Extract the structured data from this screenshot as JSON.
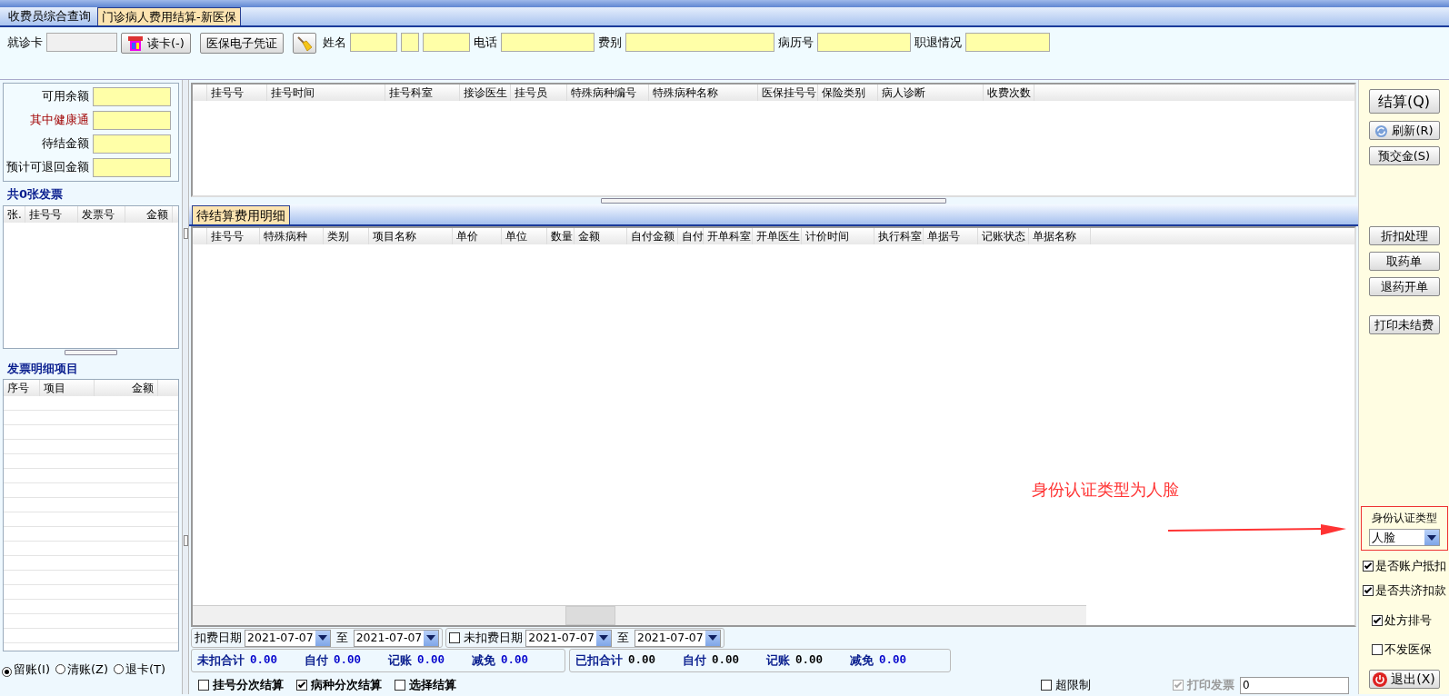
{
  "tabs": [
    {
      "label": "收费员综合查询",
      "selected": false
    },
    {
      "label": "门诊病人费用结算-新医保",
      "selected": true
    }
  ],
  "header": {
    "card_label": "就诊卡",
    "read_card_button": "读卡(-)",
    "voucher_button": "医保电子凭证",
    "fields": [
      {
        "label": "姓名",
        "kind": "split"
      },
      {
        "label": "电话",
        "kind": "single"
      },
      {
        "label": "费别",
        "kind": "wide"
      },
      {
        "label": "病历号",
        "kind": "single"
      },
      {
        "label": "职退情况",
        "kind": "single"
      }
    ]
  },
  "balances": [
    {
      "label": "可用余额",
      "emphasized": false
    },
    {
      "label": "其中健康通",
      "emphasized": true
    },
    {
      "label": "待结金额",
      "emphasized": false
    },
    {
      "label": "预计可退回金额",
      "emphasized": false
    }
  ],
  "invoices": {
    "title": "共0张发票",
    "columns": [
      "张.",
      "挂号号",
      "发票号",
      "金额"
    ]
  },
  "invoice_items": {
    "title": "发票明细项目",
    "columns": [
      "序号",
      "项目",
      "金额"
    ]
  },
  "account_options": [
    {
      "label": "留账(I)",
      "selected": true
    },
    {
      "label": "清账(Z)",
      "selected": false
    },
    {
      "label": "退卡(T)",
      "selected": false
    }
  ],
  "registrations": {
    "columns": [
      "挂号号",
      "挂号时间",
      "挂号科室",
      "接诊医生",
      "挂号员",
      "特殊病种编号",
      "特殊病种名称",
      "医保挂号号",
      "保险类别",
      "病人诊断",
      "收费次数"
    ]
  },
  "detail_tab": {
    "label": "待结算费用明细",
    "selected": true
  },
  "details": {
    "columns": [
      "挂号号",
      "特殊病种",
      "类别",
      "项目名称",
      "单价",
      "单位",
      "数量",
      "金额",
      "自付金额",
      "自付",
      "开单科室",
      "开单医生",
      "计价时间",
      "执行科室",
      "单据号",
      "记账状态",
      "单据名称"
    ]
  },
  "dates": {
    "charge_label": "扣费日期",
    "charge_from": "2021-07-07",
    "to_1": "至",
    "charge_to": "2021-07-07",
    "uncharged_label": "未扣费日期",
    "uncharged_checked": false,
    "uncharged_from": "2021-07-07",
    "to_2": "至",
    "uncharged_to": "2021-07-07"
  },
  "totals": [
    [
      {
        "label": "未扣合计",
        "value": "0.00",
        "color": "#0000cc"
      },
      {
        "label": "自付",
        "value": "0.00",
        "color": "#0000cc"
      },
      {
        "label": "记账",
        "value": "0.00",
        "color": "#0000cc"
      },
      {
        "label": "减免",
        "value": "0.00",
        "color": "#0000cc"
      }
    ],
    [
      {
        "label": "已扣合计",
        "value": "0.00",
        "color": "#000000"
      },
      {
        "label": "自付",
        "value": "0.00",
        "color": "#000000"
      },
      {
        "label": "记账",
        "value": "0.00",
        "color": "#000000"
      },
      {
        "label": "减免",
        "value": "0.00",
        "color": "#0000cc"
      }
    ]
  ],
  "options": [
    {
      "label": "挂号分次结算",
      "checked": false
    },
    {
      "label": "病种分次结算",
      "checked": true
    },
    {
      "label": "选择结算",
      "checked": false
    }
  ],
  "over_limit": {
    "label": "超限制",
    "checked": false
  },
  "print_invoice": {
    "label": "打印发票",
    "checked": true,
    "disabled": true,
    "value": "0"
  },
  "side_buttons": [
    {
      "label": "结算(Q)",
      "kind": "large"
    },
    {
      "label": "刷新(R)",
      "kind": "refresh"
    },
    {
      "label": "预交金(S)",
      "kind": "plain"
    },
    {
      "label": "折扣处理",
      "kind": "gap"
    },
    {
      "label": "取药单",
      "kind": "plain"
    },
    {
      "label": "退药开单",
      "kind": "plain"
    },
    {
      "label": "打印未结费",
      "kind": "gap"
    }
  ],
  "auth": {
    "label": "身份认证类型",
    "value": "人脸"
  },
  "side_checks": [
    {
      "label": "是否账户抵扣",
      "checked": true
    },
    {
      "label": "是否共济扣款",
      "checked": true
    },
    {
      "label": "处方排号",
      "checked": true
    },
    {
      "label": "不发医保",
      "checked": false
    }
  ],
  "exit_button": "退出(X)",
  "annotation": "身份认证类型为人脸"
}
